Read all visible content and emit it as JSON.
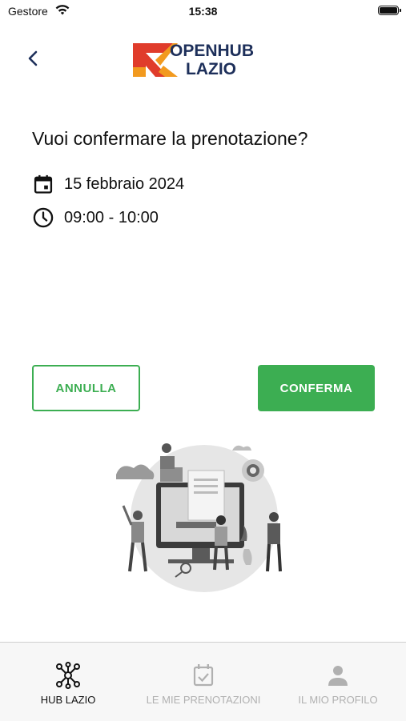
{
  "status": {
    "carrier": "Gestore",
    "time": "15:38"
  },
  "header": {
    "logo_line1": "OPENHUB",
    "logo_line2": "LAZIO"
  },
  "content": {
    "title": "Vuoi confermare la prenotazione?",
    "date": "15 febbraio 2024",
    "time_range": "09:00 - 10:00"
  },
  "actions": {
    "cancel": "ANNULLA",
    "confirm": "CONFERMA"
  },
  "colors": {
    "accent": "#3cae52",
    "logo_red": "#e03c2b",
    "logo_orange": "#f29a1f",
    "logo_blue": "#1d2f5a"
  },
  "tabs": [
    {
      "label": "HUB LAZIO",
      "icon": "network-icon",
      "active": true
    },
    {
      "label": "LE MIE PRENOTAZIONI",
      "icon": "calendar-check-icon",
      "active": false
    },
    {
      "label": "IL MIO PROFILO",
      "icon": "person-icon",
      "active": false
    }
  ]
}
